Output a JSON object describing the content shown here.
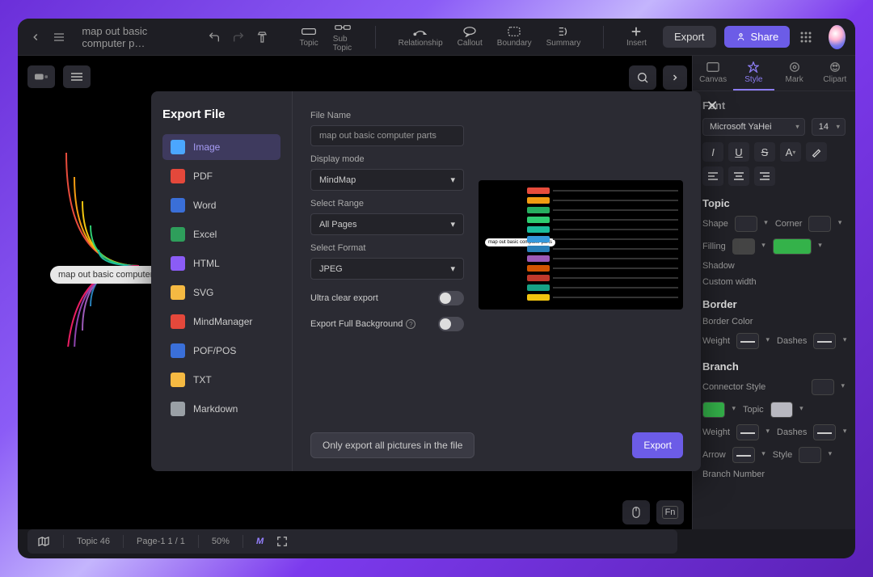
{
  "header": {
    "doc_title": "map out basic computer p…",
    "tools": [
      {
        "label": "Topic"
      },
      {
        "label": "Sub Topic"
      },
      {
        "label": "Relationship"
      },
      {
        "label": "Callout"
      },
      {
        "label": "Boundary"
      },
      {
        "label": "Summary"
      },
      {
        "label": "Insert"
      }
    ],
    "export_btn": "Export",
    "share_btn": "Share"
  },
  "canvas": {
    "center_node": "map out basic computer"
  },
  "sidepanel": {
    "tabs": [
      {
        "label": "Canvas"
      },
      {
        "label": "Style"
      },
      {
        "label": "Mark"
      },
      {
        "label": "Clipart"
      }
    ],
    "font_section": "Font",
    "font_family": "Microsoft YaHei",
    "font_size": "14",
    "topic_section": "Topic",
    "shape_label": "Shape",
    "corner_label": "Corner",
    "filling_label": "Filling",
    "shadow_label": "Shadow",
    "custom_width_label": "Custom width",
    "border_section": "Border",
    "border_color_label": "Border Color",
    "weight_label": "Weight",
    "dashes_label": "Dashes",
    "branch_section": "Branch",
    "connector_label": "Connector Style",
    "topic_label": "Topic",
    "arrow_label": "Arrow",
    "style_label": "Style",
    "branch_number_label": "Branch Number",
    "filling_color": "#34b24a",
    "branch_color": "#34b24a",
    "topic_color": "#b8b8c0"
  },
  "statusbar": {
    "topic_count": "Topic 46",
    "page_info": "Page-1  1 / 1",
    "zoom": "50%"
  },
  "modal": {
    "title": "Export File",
    "formats": [
      {
        "label": "Image",
        "color": "#4ba6ff"
      },
      {
        "label": "PDF",
        "color": "#e4483b"
      },
      {
        "label": "Word",
        "color": "#3a6fd8"
      },
      {
        "label": "Excel",
        "color": "#2e9e5b"
      },
      {
        "label": "HTML",
        "color": "#8b5cf6"
      },
      {
        "label": "SVG",
        "color": "#f5b942"
      },
      {
        "label": "MindManager",
        "color": "#e4483b"
      },
      {
        "label": "POF/POS",
        "color": "#3a6fd8"
      },
      {
        "label": "TXT",
        "color": "#f5b942"
      },
      {
        "label": "Markdown",
        "color": "#9aa0a6"
      }
    ],
    "labels": {
      "file_name": "File Name",
      "display_mode": "Display mode",
      "select_range": "Select Range",
      "select_format": "Select Format",
      "ultra_clear": "Ultra clear export",
      "export_full_bg": "Export Full Background"
    },
    "values": {
      "file_name": "map out basic computer parts",
      "display_mode": "MindMap",
      "select_range": "All Pages",
      "select_format": "JPEG"
    },
    "footer": {
      "only_export": "Only export all pictures in the file",
      "export": "Export"
    },
    "preview_node": "map out basic computer parts",
    "preview_colors": [
      "#e74c3c",
      "#f39c12",
      "#27ae60",
      "#2ecc71",
      "#1abc9c",
      "#3498db",
      "#2980b9",
      "#9b59b6",
      "#d35400",
      "#c0392b",
      "#16a085",
      "#f1c40f"
    ]
  }
}
